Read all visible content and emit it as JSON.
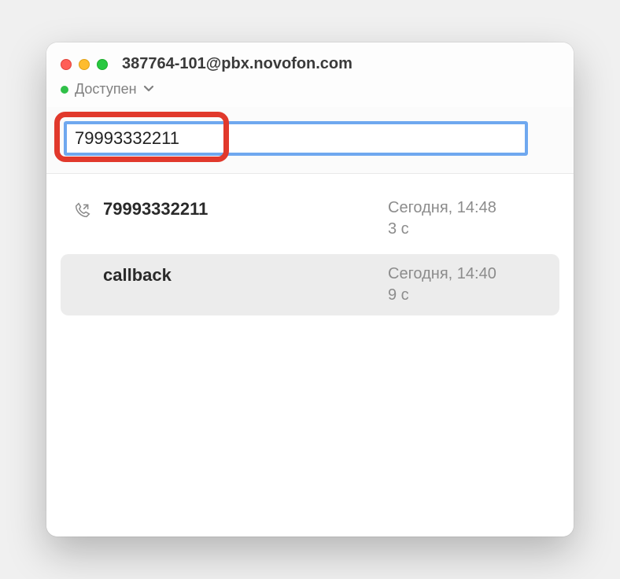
{
  "window": {
    "title": "387764-101@pbx.novofon.com"
  },
  "status": {
    "label": "Доступен",
    "color": "#30c048"
  },
  "input": {
    "value": "79993332211"
  },
  "calls": [
    {
      "name": "79993332211",
      "time": "Сегодня, 14:48",
      "duration": "3 с",
      "has_icon": true,
      "selected": false
    },
    {
      "name": "callback",
      "time": "Сегодня, 14:40",
      "duration": "9 с",
      "has_icon": false,
      "selected": true
    }
  ]
}
